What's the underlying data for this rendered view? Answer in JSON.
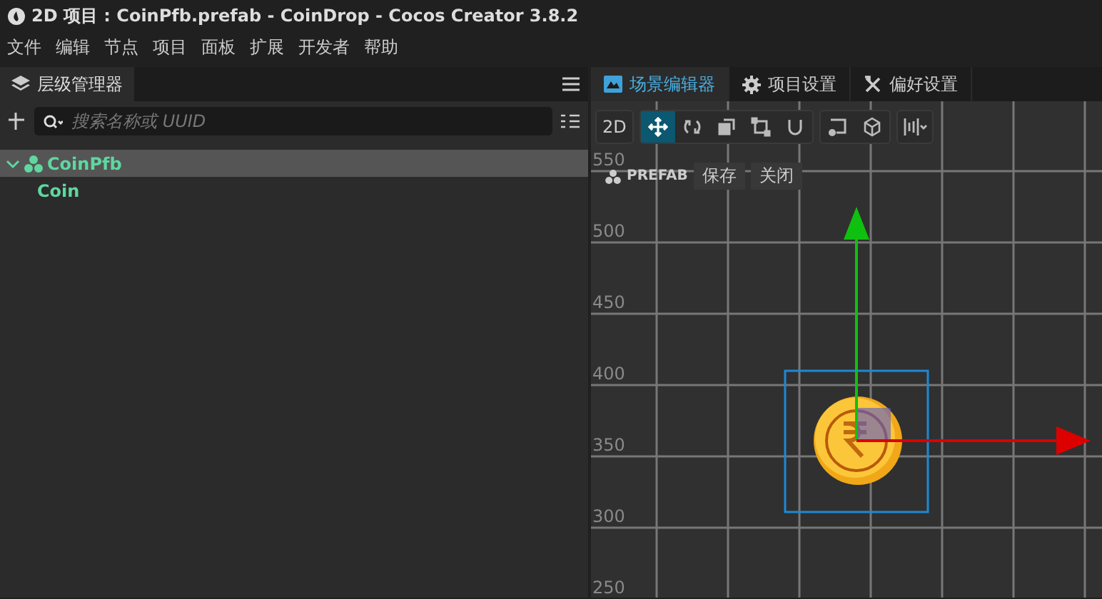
{
  "window": {
    "title": "2D 项目 : CoinPfb.prefab - CoinDrop - Cocos Creator 3.8.2"
  },
  "menu": [
    "文件",
    "编辑",
    "节点",
    "项目",
    "面板",
    "扩展",
    "开发者",
    "帮助"
  ],
  "hierarchy": {
    "tab": "层级管理器",
    "search": {
      "placeholder": "搜索名称或 UUID"
    },
    "tree": [
      {
        "label": "CoinPfb",
        "selected": true,
        "expanded": true,
        "children": [
          {
            "label": "Coin",
            "selected": false
          }
        ]
      }
    ]
  },
  "scene": {
    "tabs": [
      {
        "label": "场景编辑器",
        "kind": "scene",
        "selected": true
      },
      {
        "label": "项目设置",
        "kind": "gear",
        "selected": false
      },
      {
        "label": "偏好设置",
        "kind": "tools",
        "selected": false
      }
    ],
    "mode_button": "2D",
    "tool_groups": [
      [
        {
          "kind": "move",
          "selected": true
        },
        {
          "kind": "rotate",
          "selected": false
        },
        {
          "kind": "scale",
          "selected": false
        },
        {
          "kind": "rect",
          "selected": false
        },
        {
          "kind": "magnet",
          "selected": false
        }
      ],
      [
        {
          "kind": "pivot",
          "selected": false
        },
        {
          "kind": "cube",
          "selected": false
        }
      ],
      [
        {
          "kind": "align",
          "selected": false
        }
      ]
    ],
    "y_labels": [
      "550",
      "500",
      "450",
      "400",
      "350",
      "300",
      "250"
    ],
    "prefab_label": "PREFAB",
    "save": "保存",
    "close": "关闭"
  }
}
